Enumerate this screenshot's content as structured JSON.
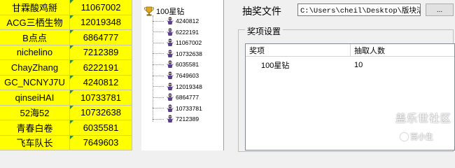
{
  "sheet": {
    "rows": [
      {
        "name": "甘霖酸鸡掰",
        "id": "11067002"
      },
      {
        "name": "ACG三栖生物",
        "id": "12019348"
      },
      {
        "name": "B点点",
        "id": "6864777"
      },
      {
        "name": "nichelino",
        "id": "7212389"
      },
      {
        "name": "ChayZhang",
        "id": "6222191"
      },
      {
        "name": "GC_NCNYJ7U",
        "id": "4240812"
      },
      {
        "name": "qinseiHAI",
        "id": "10733781"
      },
      {
        "name": "52海52",
        "id": "10732638"
      },
      {
        "name": "青春白卷",
        "id": "6035581"
      },
      {
        "name": "飞车队长",
        "id": "7649603"
      }
    ]
  },
  "tree": {
    "root_label": "100星钻",
    "root_icon": "trophy-icon",
    "node_icon": "ninja-icon",
    "nodes": [
      "4240812",
      "6222191",
      "11067002",
      "10732638",
      "6035581",
      "7649603",
      "12019348",
      "6864777",
      "10733781",
      "7212389"
    ]
  },
  "panel": {
    "file_label": "抽奖文件",
    "file_path": "C:\\Users\\cheil\\Desktop\\版块活",
    "browse_label": "...",
    "group_title": "奖项设置",
    "columns": [
      "奖项",
      "抽取人数"
    ],
    "prizes": [
      {
        "prize": "100星钻",
        "count": "10"
      }
    ]
  },
  "watermark": {
    "line1": "盖乐世社区",
    "line2": "百小生"
  },
  "colors": {
    "cell_fill": "#ffff00",
    "marker": "#2e8b3a"
  }
}
